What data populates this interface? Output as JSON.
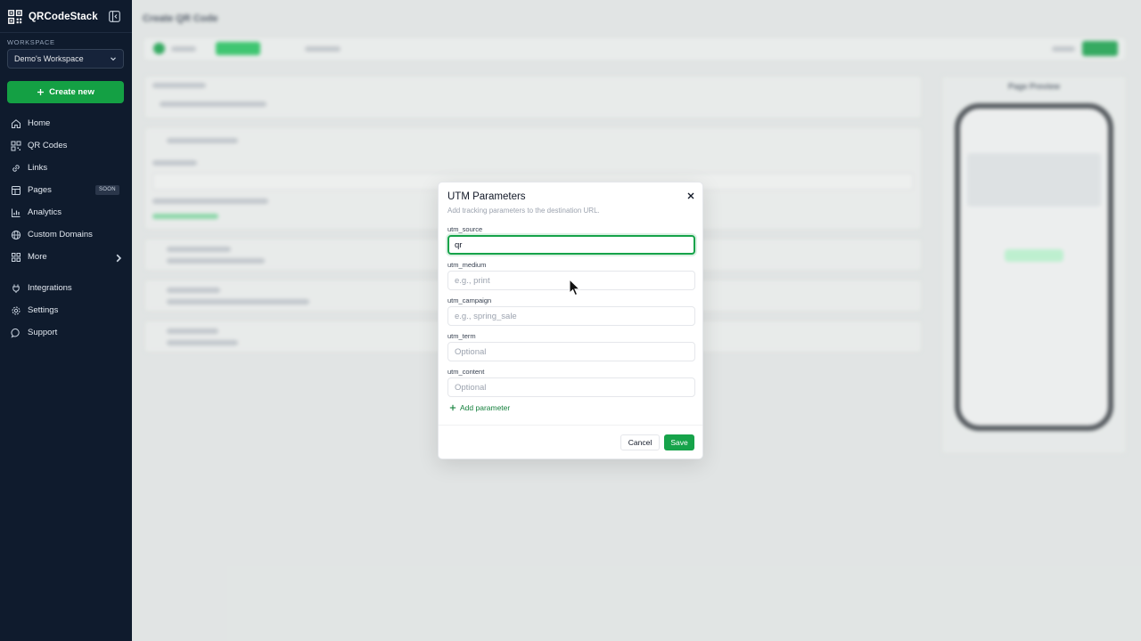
{
  "app": {
    "name": "QRCodeStack"
  },
  "workspace": {
    "label": "WORKSPACE",
    "selected": "Demo's Workspace"
  },
  "create_button": {
    "label": "Create new"
  },
  "nav": {
    "items": [
      {
        "label": "Home",
        "icon": "home-icon"
      },
      {
        "label": "QR Codes",
        "icon": "qr-code-icon"
      },
      {
        "label": "Links",
        "icon": "link-icon"
      },
      {
        "label": "Pages",
        "icon": "pages-icon",
        "badge": "SOON"
      },
      {
        "label": "Analytics",
        "icon": "analytics-icon"
      },
      {
        "label": "Custom Domains",
        "icon": "globe-icon"
      },
      {
        "label": "More",
        "icon": "grid-icon"
      }
    ],
    "secondary": [
      {
        "label": "Integrations",
        "icon": "plug-icon"
      },
      {
        "label": "Settings",
        "icon": "gear-icon"
      },
      {
        "label": "Support",
        "icon": "chat-icon"
      }
    ]
  },
  "background": {
    "page_title": "Create QR Code",
    "preview_title": "Page Preview"
  },
  "modal": {
    "title": "UTM Parameters",
    "subtitle": "Add tracking parameters to the destination URL.",
    "fields": [
      {
        "label": "utm_source",
        "value": "qr",
        "placeholder": ""
      },
      {
        "label": "utm_medium",
        "value": "",
        "placeholder": "e.g., print"
      },
      {
        "label": "utm_campaign",
        "value": "",
        "placeholder": "e.g., spring_sale"
      },
      {
        "label": "utm_term",
        "value": "",
        "placeholder": "Optional"
      },
      {
        "label": "utm_content",
        "value": "",
        "placeholder": "Optional"
      }
    ],
    "add_parameter": "Add parameter",
    "cancel": "Cancel",
    "save": "Save"
  },
  "colors": {
    "sidebar": "#0f1b2d",
    "accent": "#16a34a"
  }
}
